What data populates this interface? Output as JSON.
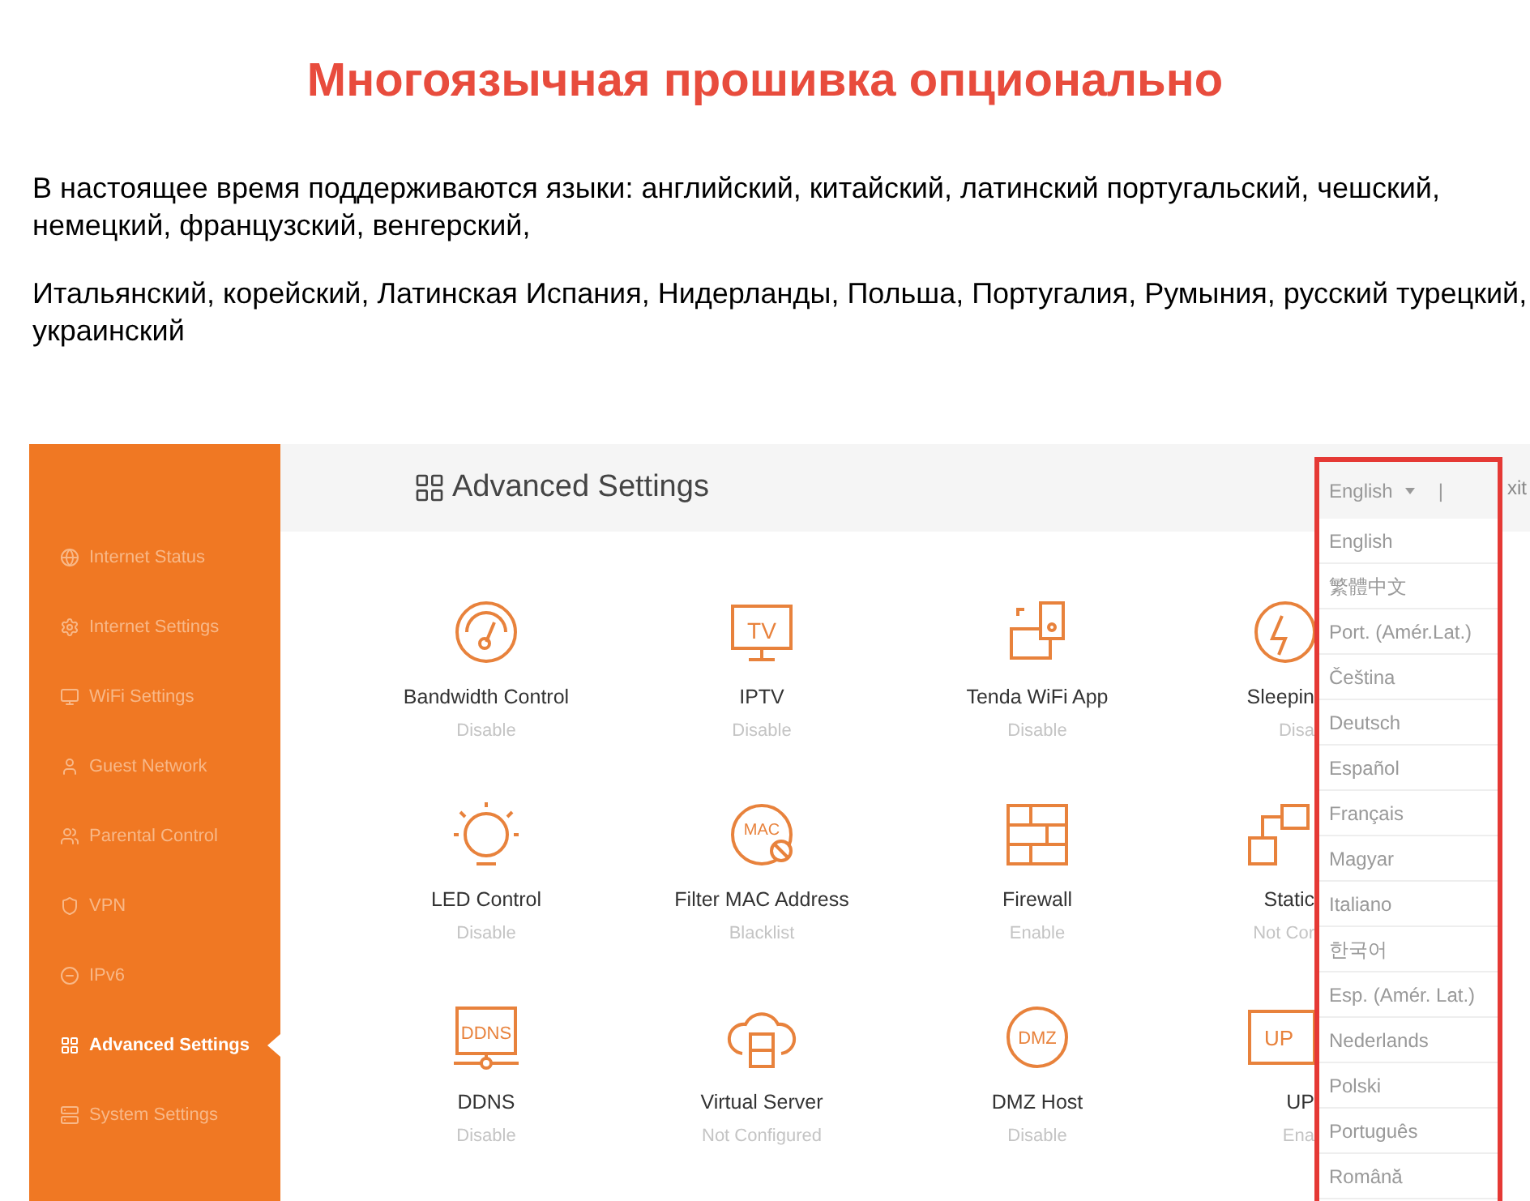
{
  "heading": "Многоязычная прошивка опционально",
  "paragraphs": [
    "В настоящее время поддерживаются языки: английский, китайский, латинский португальский, чешский, немецкий, французский, венгерский,",
    "Итальянский, корейский, Латинская Испания, Нидерланды, Польша, Португалия, Румыния, русский турецкий, украинский"
  ],
  "router": {
    "sidebar": {
      "items": [
        {
          "label": "Internet Status",
          "selected": false
        },
        {
          "label": "Internet Settings",
          "selected": false
        },
        {
          "label": "WiFi Settings",
          "selected": false
        },
        {
          "label": "Guest Network",
          "selected": false
        },
        {
          "label": "Parental Control",
          "selected": false
        },
        {
          "label": "VPN",
          "selected": false
        },
        {
          "label": "IPv6",
          "selected": false
        },
        {
          "label": "Advanced Settings",
          "selected": true
        },
        {
          "label": "System Settings",
          "selected": false
        }
      ]
    },
    "header": {
      "title": "Advanced Settings",
      "exit": "xit"
    },
    "features": [
      {
        "name": "Bandwidth Control",
        "status": "Disable"
      },
      {
        "name": "IPTV",
        "status": "Disable",
        "icon_text": "TV"
      },
      {
        "name": "Tenda WiFi App",
        "status": "Disable"
      },
      {
        "name": "Sleepin",
        "status": "Disa"
      },
      {
        "name": "LED Control",
        "status": "Disable"
      },
      {
        "name": "Filter MAC Address",
        "status": "Blacklist",
        "icon_text": "MAC"
      },
      {
        "name": "Firewall",
        "status": "Enable"
      },
      {
        "name": "Static",
        "status": "Not Cor"
      },
      {
        "name": "DDNS",
        "status": "Disable",
        "icon_text": "DDNS"
      },
      {
        "name": "Virtual Server",
        "status": "Not Configured"
      },
      {
        "name": "DMZ Host",
        "status": "Disable",
        "icon_text": "DMZ"
      },
      {
        "name": "UP",
        "status": "Ena",
        "icon_text": "UP"
      }
    ],
    "language_menu": {
      "current": "English",
      "separator": "|",
      "items": [
        "English",
        "繁體中文",
        "Port. (Amér.Lat.)",
        "Čeština",
        "Deutsch",
        "Español",
        "Français",
        "Magyar",
        "Italiano",
        "한국어",
        "Esp. (Amér. Lat.)",
        "Nederlands",
        "Polski",
        "Português",
        "Română"
      ]
    }
  }
}
